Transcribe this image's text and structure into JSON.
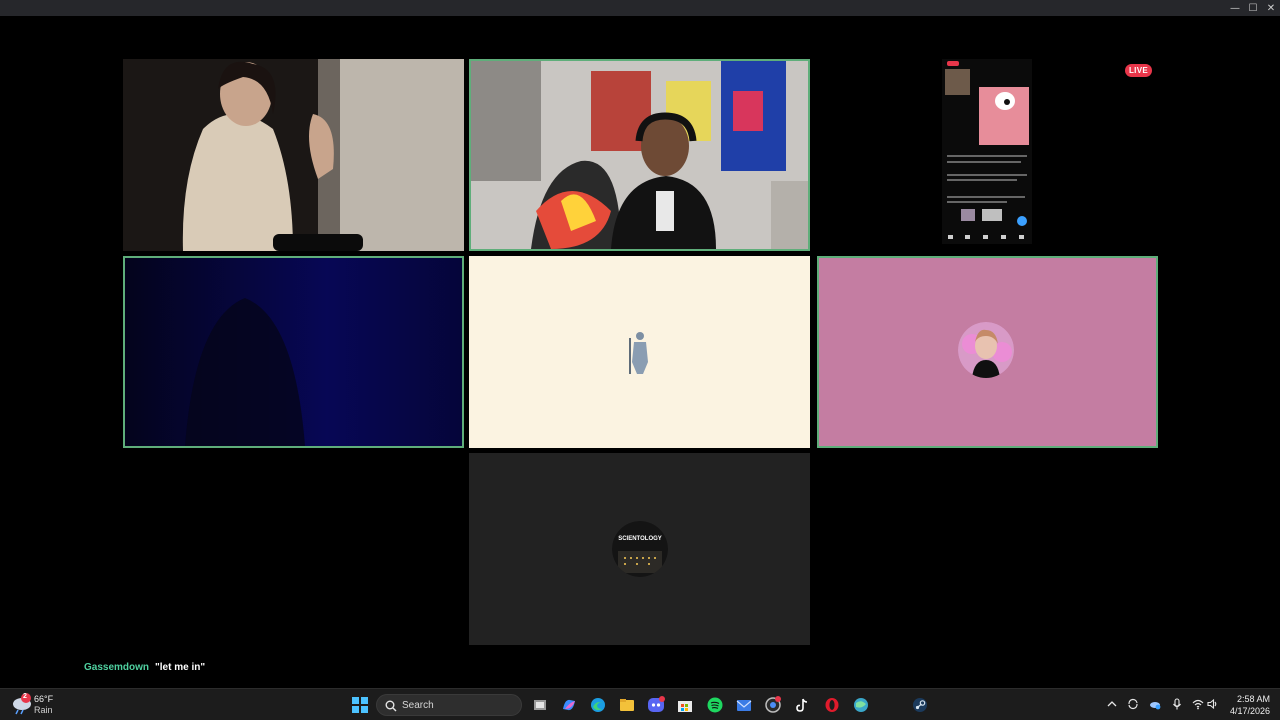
{
  "window": {
    "controls": [
      {
        "name": "minimize-button",
        "glyph": "—"
      },
      {
        "name": "maximize-button",
        "glyph": "☐"
      },
      {
        "name": "close-button",
        "glyph": "✕"
      }
    ]
  },
  "call": {
    "live_badge": "LIVE",
    "chat": {
      "username": "Gassemdown",
      "message": "\"let me in\""
    },
    "center_avatar_text": "SCIENTOLOGY"
  },
  "taskbar": {
    "weather": {
      "temp": "66°F",
      "condition": "Rain",
      "badge": "2"
    },
    "search_label": "Search",
    "clock": {
      "time": "2:58 AM",
      "date": "4/17/2026"
    },
    "apps": [
      "start-icon",
      "search-icon",
      "task-view-icon",
      "copilot-icon",
      "edge-icon",
      "file-explorer-icon",
      "discord-icon",
      "store-icon",
      "spotify-icon",
      "mail-icon",
      "chrome-icon",
      "tiktok-icon",
      "opera-icon",
      "browser-icon",
      "steam-icon"
    ],
    "tray": [
      "chevron-up-icon",
      "sync-icon",
      "onedrive-icon",
      "microphone-icon",
      "wifi-icon",
      "volume-icon"
    ]
  },
  "colors": {
    "speaking_border": "#5fae7a",
    "live_red": "#e8364a",
    "chat_user": "#4fd1a0",
    "cream_tile": "#fbf3e1",
    "pink_tile": "#c47da2",
    "navy_tile": "#06063a",
    "gray_tile": "#222222"
  }
}
